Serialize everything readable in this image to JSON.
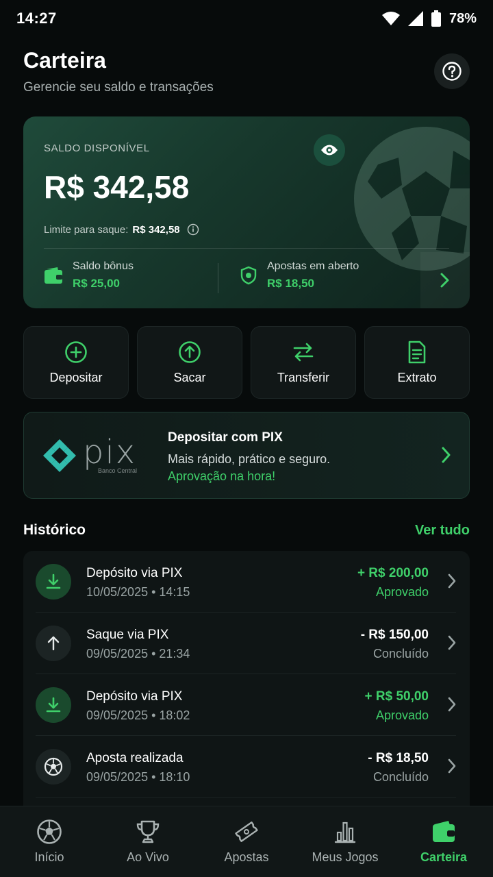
{
  "status_bar": {
    "time": "14:27",
    "battery": "78%"
  },
  "header": {
    "title": "Carteira",
    "subtitle": "Gerencie seu saldo e transações"
  },
  "balance": {
    "label": "SALDO DISPONÍVEL",
    "value": "R$ 342,58",
    "limit_label": "Limite para saque:",
    "limit_value": "R$ 342,58",
    "bonus_label": "Saldo bônus",
    "bonus_value": "R$ 25,00",
    "open_bets_label": "Apostas em aberto",
    "open_bets_value": "R$ 18,50"
  },
  "actions": [
    {
      "label": "Depositar",
      "icon": "plus-circle-icon"
    },
    {
      "label": "Sacar",
      "icon": "upload-circle-icon"
    },
    {
      "label": "Transferir",
      "icon": "transfer-icon"
    },
    {
      "label": "Extrato",
      "icon": "document-icon"
    }
  ],
  "pix": {
    "logo_text": "pix",
    "logo_subtext": "Banco Central",
    "title": "Depositar com PIX",
    "description": "Mais rápido, prático e seguro.",
    "highlight": "Aprovação na hora!"
  },
  "history": {
    "title": "Histórico",
    "see_all": "Ver tudo",
    "items": [
      {
        "title": "Depósito via PIX",
        "date": "10/05/2025 • 14:15",
        "amount": "+ R$ 200,00",
        "status": "Aprovado",
        "type": "deposit"
      },
      {
        "title": "Saque via PIX",
        "date": "09/05/2025 • 21:34",
        "amount": "- R$ 150,00",
        "status": "Concluído",
        "type": "withdraw"
      },
      {
        "title": "Depósito via PIX",
        "date": "09/05/2025 • 18:02",
        "amount": "+ R$ 50,00",
        "status": "Aprovado",
        "type": "deposit"
      },
      {
        "title": "Aposta realizada",
        "date": "09/05/2025 • 18:10",
        "amount": "- R$ 18,50",
        "status": "Concluído",
        "type": "bet"
      }
    ]
  },
  "nav": [
    {
      "label": "Início",
      "icon": "soccer-ball-icon",
      "active": false
    },
    {
      "label": "Ao Vivo",
      "icon": "trophy-icon",
      "active": false
    },
    {
      "label": "Apostas",
      "icon": "ticket-icon",
      "active": false
    },
    {
      "label": "Meus Jogos",
      "icon": "bar-chart-icon",
      "active": false
    },
    {
      "label": "Carteira",
      "icon": "wallet-icon",
      "active": true
    }
  ],
  "colors": {
    "accent": "#3fd06a",
    "background": "#070b0b",
    "card": "#111717"
  }
}
